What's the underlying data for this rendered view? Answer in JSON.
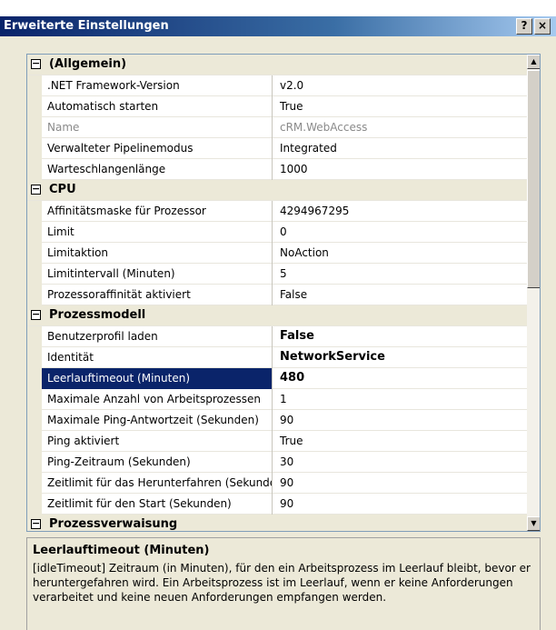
{
  "window": {
    "title": "Erweiterte Einstellungen",
    "help_label": "?",
    "close_label": "×"
  },
  "grid": {
    "categories": [
      {
        "label": "(Allgemein)",
        "toggle": "−",
        "properties": [
          {
            "name": ".NET Framework-Version",
            "value": "v2.0"
          },
          {
            "name": "Automatisch starten",
            "value": "True"
          },
          {
            "name": "Name",
            "value": "cRM.WebAccess",
            "disabled": true
          },
          {
            "name": "Verwalteter Pipelinemodus",
            "value": "Integrated"
          },
          {
            "name": "Warteschlangenlänge",
            "value": "1000"
          }
        ]
      },
      {
        "label": "CPU",
        "toggle": "−",
        "properties": [
          {
            "name": "Affinitätsmaske für Prozessor",
            "value": "4294967295"
          },
          {
            "name": "Limit",
            "value": "0"
          },
          {
            "name": "Limitaktion",
            "value": "NoAction"
          },
          {
            "name": "Limitintervall (Minuten)",
            "value": "5"
          },
          {
            "name": "Prozessoraffinität aktiviert",
            "value": "False"
          }
        ]
      },
      {
        "label": "Prozessmodell",
        "toggle": "−",
        "properties": [
          {
            "name": "Benutzerprofil laden",
            "value": "False",
            "bold": true
          },
          {
            "name": "Identität",
            "value": "NetworkService",
            "bold": true
          },
          {
            "name": "Leerlauftimeout (Minuten)",
            "value": "480",
            "bold": true,
            "selected": true
          },
          {
            "name": "Maximale Anzahl von Arbeitsprozessen",
            "value": "1"
          },
          {
            "name": "Maximale Ping-Antwortzeit (Sekunden)",
            "value": "90"
          },
          {
            "name": "Ping aktiviert",
            "value": "True"
          },
          {
            "name": "Ping-Zeitraum (Sekunden)",
            "value": "30"
          },
          {
            "name": "Zeitlimit für das Herunterfahren (Sekunden)",
            "value": "90"
          },
          {
            "name": "Zeitlimit für den Start (Sekunden)",
            "value": "90"
          }
        ]
      },
      {
        "label": "Prozessverwaisung",
        "toggle": "−",
        "properties": []
      }
    ]
  },
  "description": {
    "title": "Leerlauftimeout (Minuten)",
    "text": "[idleTimeout] Zeitraum (in Minuten), für den ein Arbeitsprozess im Leerlauf bleibt, bevor er heruntergefahren wird. Ein Arbeitsprozess ist im Leerlauf, wenn er keine Anforderungen verarbeitet und keine neuen Anforderungen empfangen werden."
  },
  "colors": {
    "selection": "#0a246a",
    "category_bg": "#ece9d8"
  }
}
